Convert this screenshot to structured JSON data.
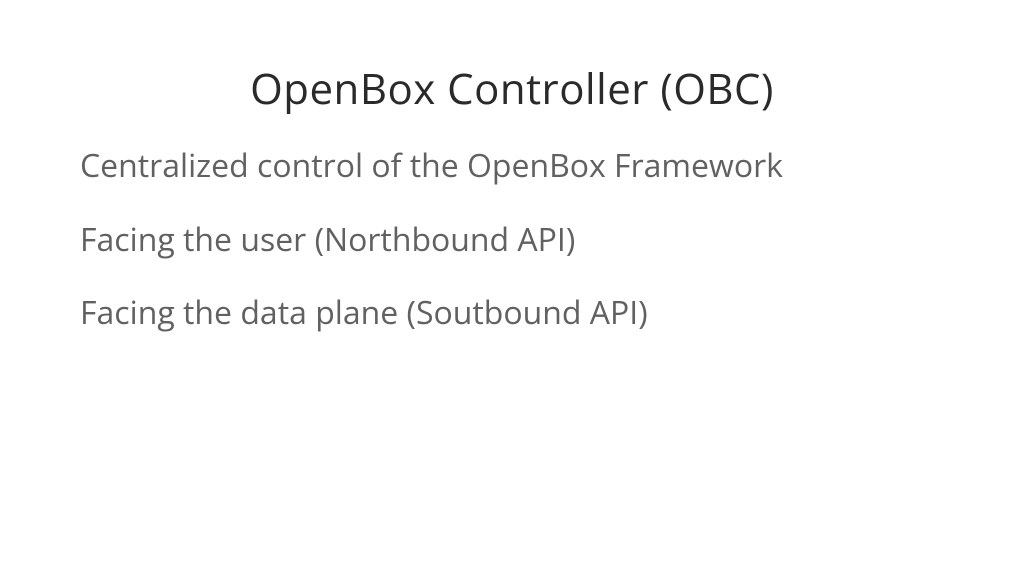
{
  "slide": {
    "title": "OpenBox Controller (OBC)",
    "bullets": [
      "Centralized control of the OpenBox Framework",
      "Facing the user (Northbound API)",
      "Facing the data plane (Soutbound API)"
    ]
  }
}
